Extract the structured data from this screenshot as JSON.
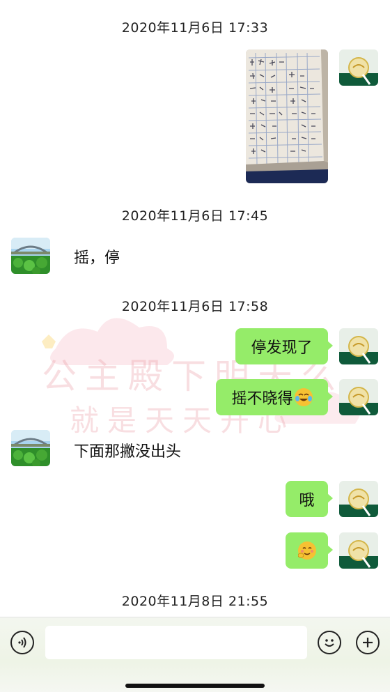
{
  "timestamps": [
    "2020年11月6日 17:33",
    "2020年11月6日 17:45",
    "2020年11月6日 17:58",
    "2020年11月8日 21:55"
  ],
  "messages": {
    "in_1": "摇，停",
    "out_1": "停发现了",
    "out_2": "摇不晓得",
    "in_2": "下面那撇没出头",
    "out_3": "哦"
  },
  "watermark": {
    "line1": "公主殿下明天么",
    "line2": "就是天天开心"
  },
  "icons": {
    "voice": "voice-icon",
    "emoji": "emoji-icon",
    "add": "add-icon",
    "laugh": "laughing-tears-emoji",
    "shy": "shy-emoji"
  },
  "colors": {
    "bubble_out": "#95ec69",
    "background": "#ffffff"
  }
}
